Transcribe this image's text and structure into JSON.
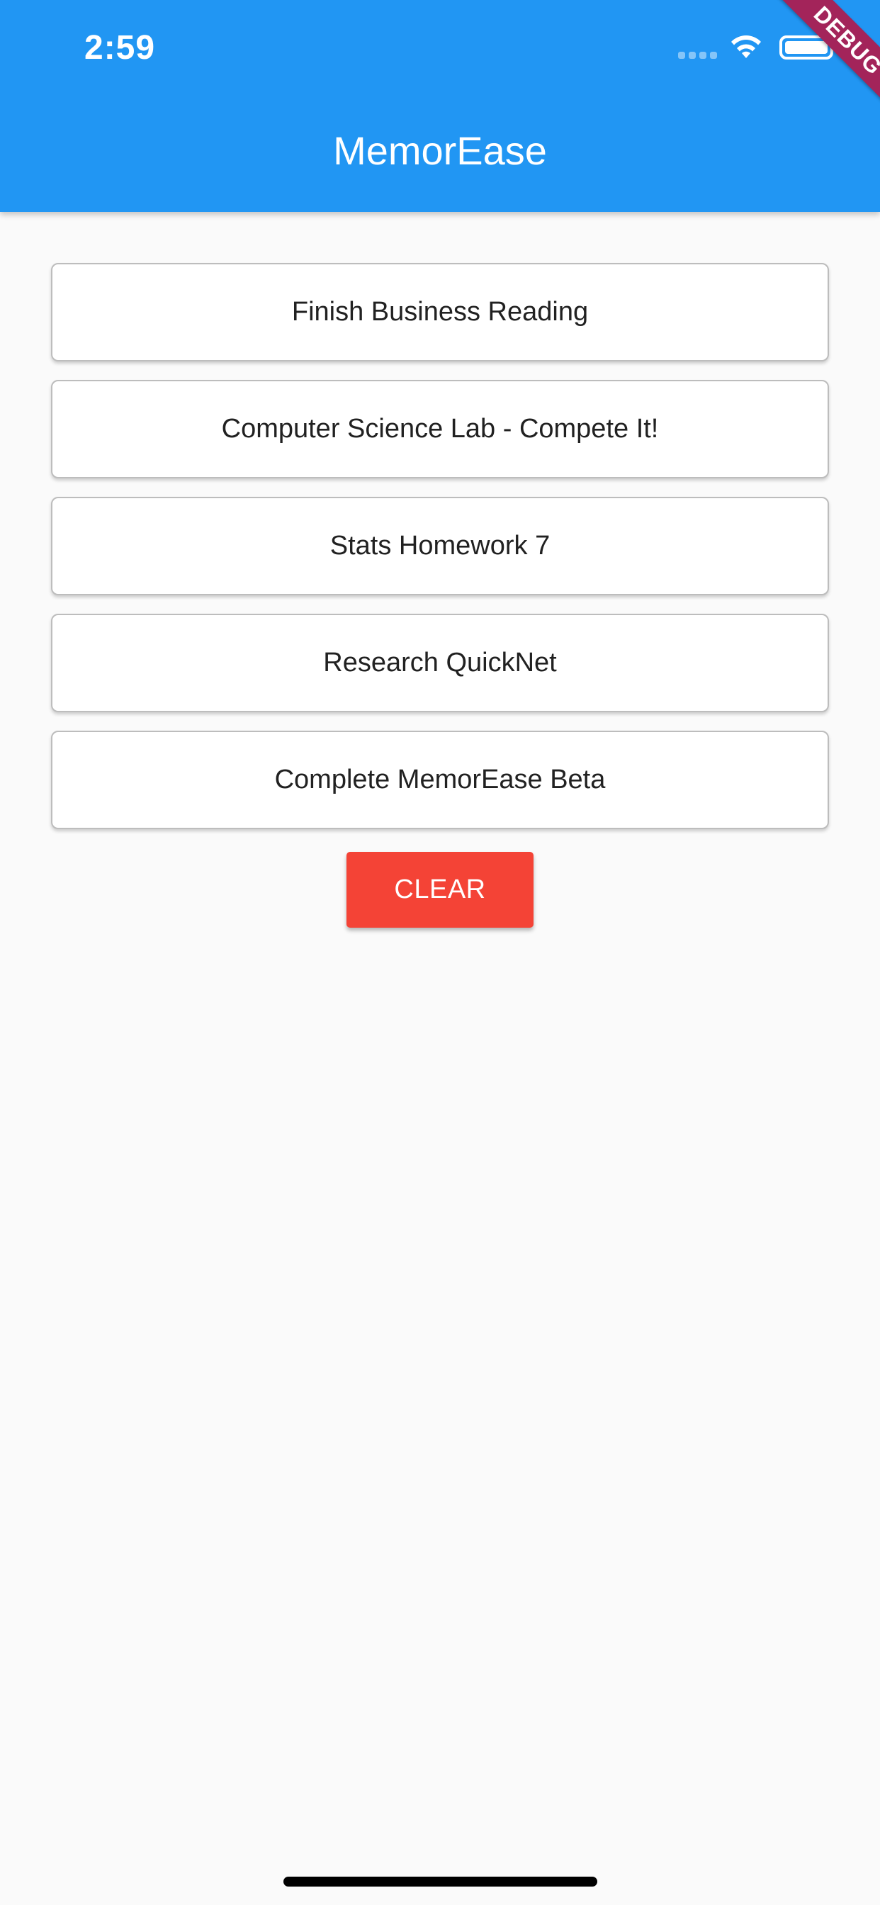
{
  "status_bar": {
    "time": "2:59"
  },
  "app_bar": {
    "title": "MemorEase",
    "debug_banner": "DEBUG",
    "color": "#2196f3"
  },
  "tasks": [
    {
      "label": "Finish Business Reading"
    },
    {
      "label": "Computer Science Lab - Compete It!"
    },
    {
      "label": "Stats Homework 7"
    },
    {
      "label": "Research QuickNet"
    },
    {
      "label": "Complete MemorEase Beta"
    }
  ],
  "actions": {
    "clear_label": "CLEAR",
    "clear_color": "#f44336"
  },
  "icons": {
    "signal": "cellular-signal-icon",
    "wifi": "wifi-icon",
    "battery": "battery-icon"
  }
}
